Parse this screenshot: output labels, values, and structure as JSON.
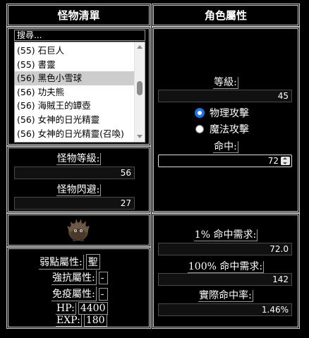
{
  "monster_list": {
    "title": "怪物清單",
    "search_placeholder": "搜尋...",
    "items": [
      {
        "label": "(55) 石巨人",
        "selected": false
      },
      {
        "label": "(55) 書靈",
        "selected": false
      },
      {
        "label": "(56) 黑色小雪球",
        "selected": true
      },
      {
        "label": "(56) 功夫熊",
        "selected": false
      },
      {
        "label": "(56) 海賊王的罈壺",
        "selected": false
      },
      {
        "label": "(56) 女神的日光精靈",
        "selected": false
      },
      {
        "label": "(56) 女神的日光精靈(召喚)",
        "selected": false
      }
    ]
  },
  "monster_stats": {
    "level_label": "怪物等級:",
    "level_value": "56",
    "evasion_label": "怪物閃避:",
    "evasion_value": "27"
  },
  "monster_info": {
    "weakness_label": "弱點屬性:",
    "weakness_value": "聖",
    "resist_label": "強抗屬性:",
    "resist_value": "-",
    "immune_label": "免疫屬性:",
    "immune_value": "-",
    "hp_label": "HP:",
    "hp_value": "4400",
    "exp_label": "EXP:",
    "exp_value": "180"
  },
  "character": {
    "title": "角色屬性",
    "level_label": "等級:",
    "level_value": "45",
    "physical_label": "物理攻擊",
    "magic_label": "魔法攻擊",
    "attack_type": "physical",
    "accuracy_label": "命中:",
    "accuracy_value": "72"
  },
  "results": {
    "hit1_label": "1% 命中需求:",
    "hit1_value": "72.0",
    "hit100_label": "100% 命中需求:",
    "hit100_value": "142",
    "actual_label": "實際命中率:",
    "actual_value": "1.46%"
  },
  "colors": {
    "accent": "#1a73e8",
    "panel_border": "#cfcfcf",
    "background": "#000000"
  }
}
